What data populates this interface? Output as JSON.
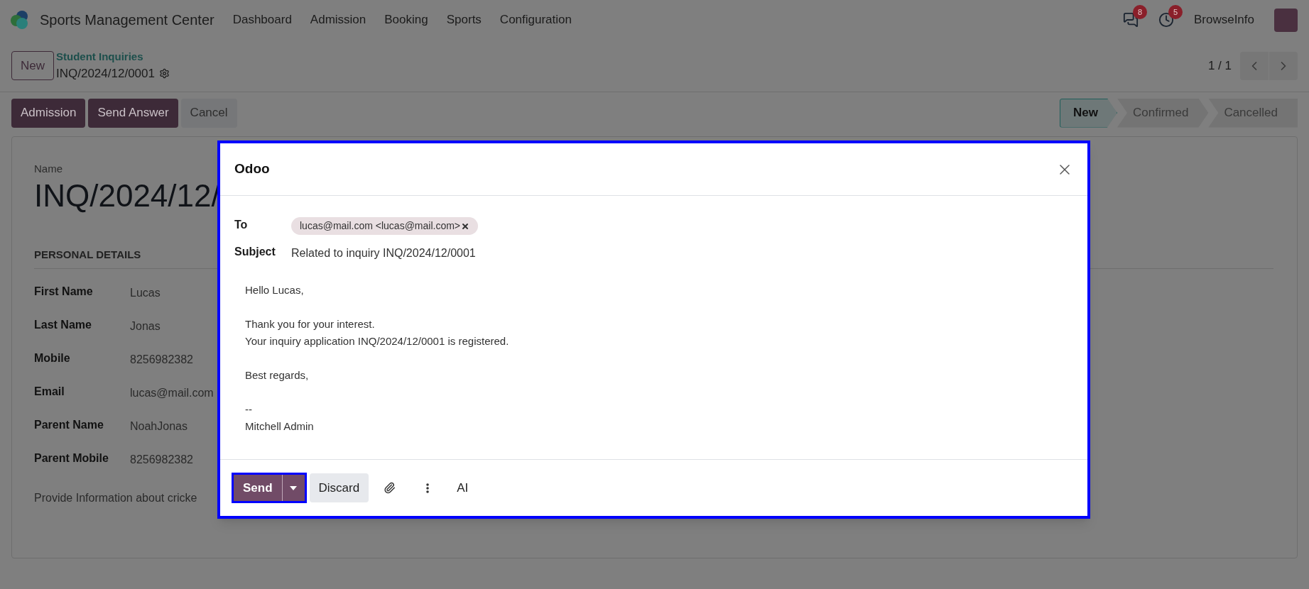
{
  "app": {
    "title": "Sports Management Center",
    "menu": [
      "Dashboard",
      "Admission",
      "Booking",
      "Sports",
      "Configuration"
    ],
    "messages_badge": "8",
    "activities_badge": "5",
    "company": "BrowseInfo"
  },
  "control_panel": {
    "new_button": "New",
    "breadcrumb": "Student Inquiries",
    "record": "INQ/2024/12/0001",
    "pager": "1 / 1"
  },
  "actions": [
    {
      "label": "Admission",
      "kind": "primary"
    },
    {
      "label": "Send Answer",
      "kind": "primary"
    },
    {
      "label": "Cancel",
      "kind": "secondary"
    }
  ],
  "statuses": [
    {
      "label": "New",
      "selected": true
    },
    {
      "label": "Confirmed",
      "selected": false
    },
    {
      "label": "Cancelled",
      "selected": false
    }
  ],
  "form": {
    "name_label": "Name",
    "name_value": "INQ/2024/12/",
    "section": "PERSONAL DETAILS",
    "fields": [
      {
        "label": "First Name",
        "value": "Lucas"
      },
      {
        "label": "Last Name",
        "value": "Jonas"
      },
      {
        "label": "Mobile",
        "value": "8256982382"
      },
      {
        "label": "Email",
        "value": "lucas@mail.com"
      },
      {
        "label": "Parent Name",
        "value": "NoahJonas"
      },
      {
        "label": "Parent Mobile",
        "value": "8256982382"
      }
    ],
    "note": "Provide Information about cricke"
  },
  "dialog": {
    "title": "Odoo",
    "to_label": "To",
    "recipients": [
      "lucas@mail.com <lucas@mail.com>"
    ],
    "subject_label": "Subject",
    "subject": "Related to inquiry INQ/2024/12/0001",
    "body": [
      [
        "Hello Lucas,"
      ],
      [
        "Thank you for your interest.",
        "Your inquiry application INQ/2024/12/0001 is registered."
      ],
      [
        "Best regards,"
      ],
      [
        "--",
        "Mitchell Admin"
      ]
    ],
    "send": "Send",
    "discard": "Discard",
    "ai": "AI"
  }
}
